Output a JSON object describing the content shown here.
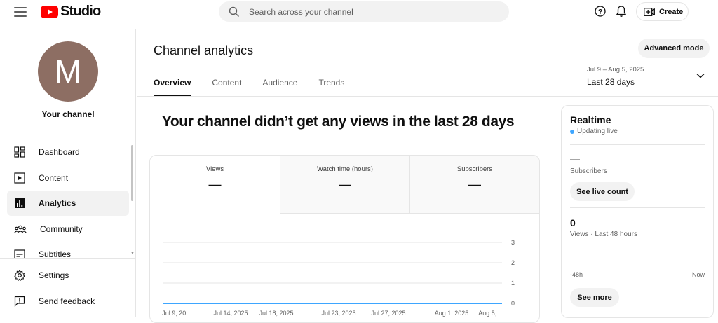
{
  "topbar": {
    "logo_text": "Studio",
    "search_placeholder": "Search across your channel",
    "create_label": "Create"
  },
  "sidebar": {
    "avatar_letter": "M",
    "avatar_color": "#8d6e63",
    "channel_label": "Your channel",
    "items": [
      {
        "label": "Dashboard",
        "icon": "dashboard-icon"
      },
      {
        "label": "Content",
        "icon": "content-icon"
      },
      {
        "label": "Analytics",
        "icon": "analytics-icon",
        "active": true
      },
      {
        "label": "Community",
        "icon": "community-icon"
      },
      {
        "label": "Subtitles",
        "icon": "subtitles-icon"
      }
    ],
    "bottom_items": [
      {
        "label": "Settings",
        "icon": "settings-icon"
      },
      {
        "label": "Send feedback",
        "icon": "feedback-icon"
      }
    ]
  },
  "main": {
    "title": "Channel analytics",
    "advanced_mode_label": "Advanced mode",
    "tabs": [
      "Overview",
      "Content",
      "Audience",
      "Trends"
    ],
    "active_tab": "Overview",
    "date_range": {
      "dates": "Jul 9 – Aug 5, 2025",
      "label": "Last 28 days"
    },
    "headline": "Your channel didn’t get any views in the last 28 days",
    "metrics": [
      {
        "label": "Views",
        "value": "—"
      },
      {
        "label": "Watch time (hours)",
        "value": "—"
      },
      {
        "label": "Subscribers",
        "value": "—"
      }
    ]
  },
  "chart_data": {
    "type": "line",
    "x_tick_labels": [
      "Jul 9, 20...",
      "Jul 14, 2025",
      "Jul 18, 2025",
      "Jul 23, 2025",
      "Jul 27, 2025",
      "Aug 1, 2025",
      "Aug 5,..."
    ],
    "y_ticks": [
      0,
      1,
      2,
      3
    ],
    "ylim": [
      0,
      3
    ],
    "series": [
      {
        "values": [
          0,
          0,
          0,
          0,
          0,
          0,
          0
        ],
        "color": "#3ea6ff"
      }
    ],
    "grid": true
  },
  "realtime": {
    "title": "Realtime",
    "live_label": "Updating live",
    "subscribers_value": "—",
    "subscribers_label": "Subscribers",
    "live_count_button": "See live count",
    "views_value": "0",
    "views_label": "Views · Last 48 hours",
    "axis_start": "-48h",
    "axis_end": "Now",
    "see_more_button": "See more"
  },
  "colors": {
    "brand_red": "#ff0000",
    "live_blue": "#3ea6ff",
    "text": "#0f0f0f",
    "muted": "#606060"
  }
}
